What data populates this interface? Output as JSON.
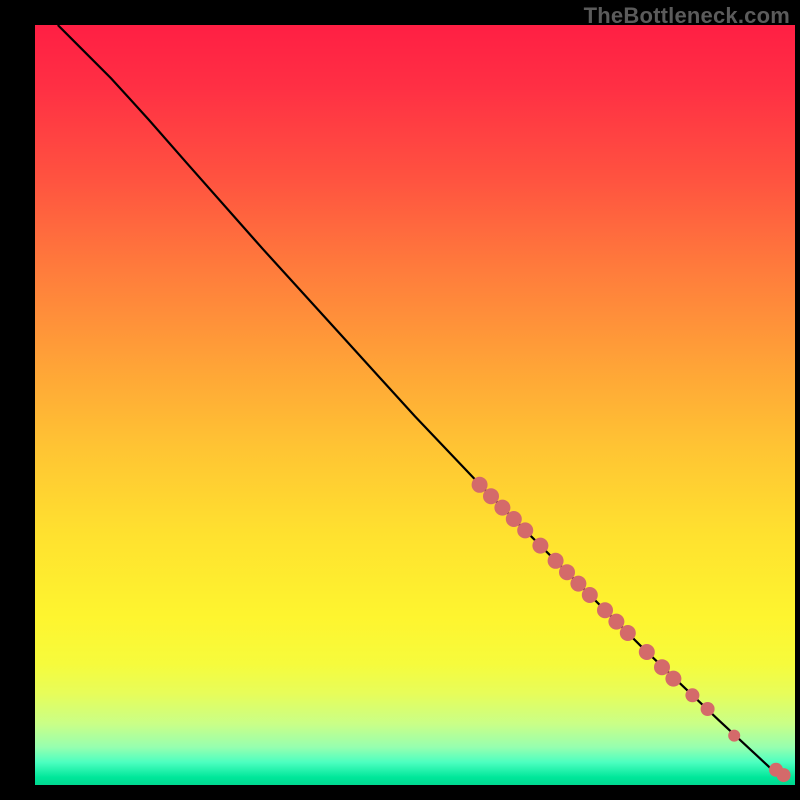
{
  "attribution": "TheBottleneck.com",
  "colors": {
    "point_fill": "#d46a6a",
    "curve_stroke": "#000000",
    "background_top": "#ff1f44",
    "background_bottom": "#00d890",
    "page_bg": "#000000"
  },
  "chart_data": {
    "type": "scatter",
    "title": "",
    "xlabel": "",
    "ylabel": "",
    "xlim": [
      0,
      100
    ],
    "ylim": [
      0,
      100
    ],
    "grid": false,
    "legend": false,
    "curve": [
      {
        "x": 3,
        "y": 100
      },
      {
        "x": 6,
        "y": 97
      },
      {
        "x": 10,
        "y": 93
      },
      {
        "x": 15,
        "y": 87.5
      },
      {
        "x": 20,
        "y": 81.8
      },
      {
        "x": 30,
        "y": 70.5
      },
      {
        "x": 40,
        "y": 59.5
      },
      {
        "x": 50,
        "y": 48.5
      },
      {
        "x": 60,
        "y": 38
      },
      {
        "x": 70,
        "y": 28
      },
      {
        "x": 80,
        "y": 18
      },
      {
        "x": 90,
        "y": 8.5
      },
      {
        "x": 97,
        "y": 2
      },
      {
        "x": 99,
        "y": 1
      }
    ],
    "series": [
      {
        "name": "points",
        "points": [
          {
            "x": 58.5,
            "y": 39.5,
            "r": 8
          },
          {
            "x": 60.0,
            "y": 38.0,
            "r": 8
          },
          {
            "x": 61.5,
            "y": 36.5,
            "r": 8
          },
          {
            "x": 63.0,
            "y": 35.0,
            "r": 8
          },
          {
            "x": 64.5,
            "y": 33.5,
            "r": 8
          },
          {
            "x": 66.5,
            "y": 31.5,
            "r": 8
          },
          {
            "x": 68.5,
            "y": 29.5,
            "r": 8
          },
          {
            "x": 70.0,
            "y": 28.0,
            "r": 8
          },
          {
            "x": 71.5,
            "y": 26.5,
            "r": 8
          },
          {
            "x": 73.0,
            "y": 25.0,
            "r": 8
          },
          {
            "x": 75.0,
            "y": 23.0,
            "r": 8
          },
          {
            "x": 76.5,
            "y": 21.5,
            "r": 8
          },
          {
            "x": 78.0,
            "y": 20.0,
            "r": 8
          },
          {
            "x": 80.5,
            "y": 17.5,
            "r": 8
          },
          {
            "x": 82.5,
            "y": 15.5,
            "r": 8
          },
          {
            "x": 84.0,
            "y": 14.0,
            "r": 8
          },
          {
            "x": 86.5,
            "y": 11.8,
            "r": 7
          },
          {
            "x": 88.5,
            "y": 10.0,
            "r": 7
          },
          {
            "x": 92.0,
            "y": 6.5,
            "r": 6
          },
          {
            "x": 97.5,
            "y": 2.0,
            "r": 7
          },
          {
            "x": 98.5,
            "y": 1.3,
            "r": 7
          }
        ]
      }
    ]
  }
}
